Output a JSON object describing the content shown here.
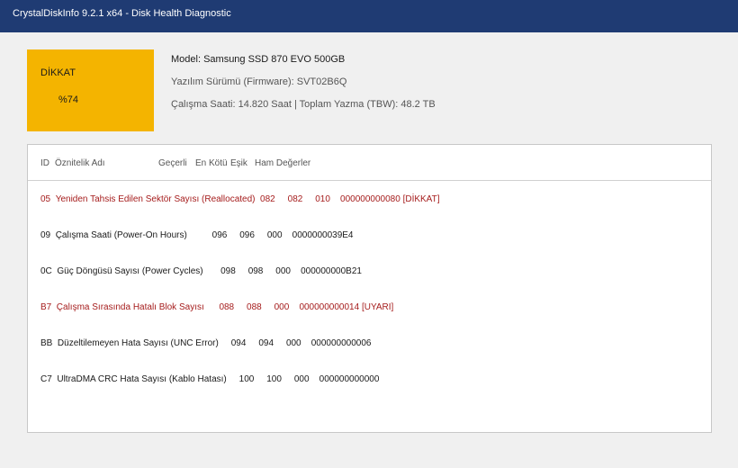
{
  "window": {
    "title": "CrystalDiskInfo 9.2.1 x64 - Disk Health Diagnostic"
  },
  "status": {
    "label": "DİKKAT",
    "percent": "%74",
    "color": "#f4b400"
  },
  "drive": {
    "model": "Model: Samsung SSD 870 EVO 500GB",
    "firmware": "Yazılım Sürümü (Firmware): SVT02B6Q",
    "hours_write": "Çalışma Saati: 14.820 Saat | Toplam Yazma (TBW): 48.2 TB"
  },
  "table": {
    "headers": {
      "id": "ID",
      "name": "Öznitelik Adı",
      "current": "Geçerli",
      "worst": "En Kötü",
      "threshold": "Eşik",
      "raw": "Ham Değerler"
    },
    "rows": [
      {
        "id": "05",
        "name": "Yeniden Tahsis Edilen Sektör Sayısı (Reallocated)",
        "current": "082",
        "worst": "082",
        "threshold": "010",
        "raw": "000000000080 [DİKKAT]",
        "warn": true
      },
      {
        "id": "09",
        "name": "Çalışma Saati (Power-On Hours)",
        "current": "096",
        "worst": "096",
        "threshold": "000",
        "raw": "0000000039E4",
        "warn": false
      },
      {
        "id": "0C",
        "name": "Güç Döngüsü Sayısı (Power Cycles)",
        "current": "098",
        "worst": "098",
        "threshold": "000",
        "raw": "000000000B21",
        "warn": false
      },
      {
        "id": "B7",
        "name": "Çalışma Sırasında Hatalı Blok Sayısı",
        "current": "088",
        "worst": "088",
        "threshold": "000",
        "raw": "000000000014 [UYARI]",
        "warn": true
      },
      {
        "id": "BB",
        "name": "Düzeltilemeyen Hata Sayısı (UNC Error)",
        "current": "094",
        "worst": "094",
        "threshold": "000",
        "raw": "000000000006",
        "warn": false
      },
      {
        "id": "C7",
        "name": "UltraDMA CRC Hata Sayısı (Kablo Hatası)",
        "current": "100",
        "worst": "100",
        "threshold": "000",
        "raw": "000000000000",
        "warn": false
      }
    ]
  },
  "colors": {
    "titlebar": "#1f3b73",
    "warn_text": "#a51c1c"
  }
}
